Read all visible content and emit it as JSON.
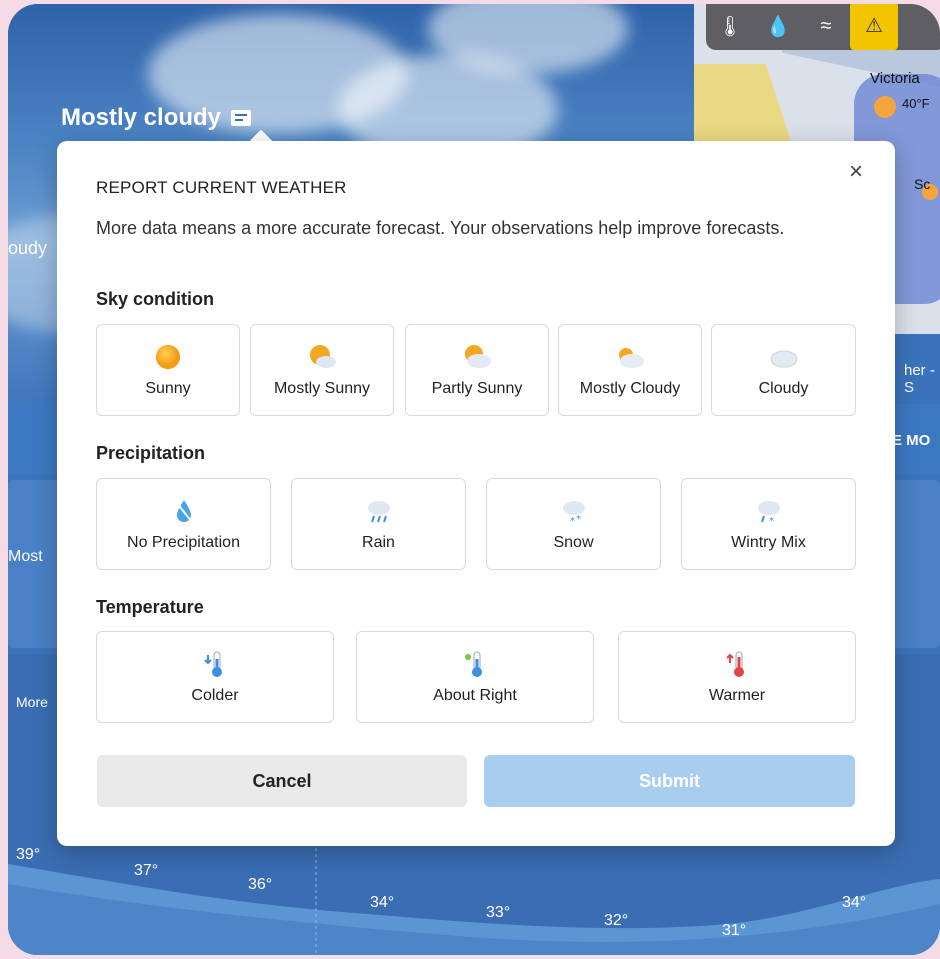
{
  "background": {
    "condition_label": "Mostly cloudy",
    "side_label_1": "oudy",
    "side_label_2": "Most",
    "side_label_3": "More",
    "band_label": "E MO",
    "map": {
      "city": "Victoria",
      "city_temp": "40°F",
      "city2": "Sc",
      "footer_text": "her - S",
      "toolbar_icons": [
        "thermometer-icon",
        "drop-icon",
        "wind-icon",
        "warning-icon"
      ]
    },
    "hourly_temps": [
      "39°",
      "37°",
      "36°",
      "34°",
      "33°",
      "32°",
      "31°",
      "34°"
    ]
  },
  "modal": {
    "title": "REPORT CURRENT WEATHER",
    "description": "More data means a more accurate forecast. Your observations help improve forecasts.",
    "sky": {
      "title": "Sky condition",
      "options": [
        {
          "label": "Sunny",
          "icon": "sun-icon"
        },
        {
          "label": "Mostly Sunny",
          "icon": "mostly-sunny-icon"
        },
        {
          "label": "Partly Sunny",
          "icon": "partly-sunny-icon"
        },
        {
          "label": "Mostly Cloudy",
          "icon": "mostly-cloudy-icon"
        },
        {
          "label": "Cloudy",
          "icon": "cloud-icon"
        }
      ]
    },
    "precipitation": {
      "title": "Precipitation",
      "options": [
        {
          "label": "No Precipitation",
          "icon": "no-precipitation-icon"
        },
        {
          "label": "Rain",
          "icon": "rain-icon"
        },
        {
          "label": "Snow",
          "icon": "snow-icon"
        },
        {
          "label": "Wintry Mix",
          "icon": "wintry-mix-icon"
        }
      ]
    },
    "temperature": {
      "title": "Temperature",
      "options": [
        {
          "label": "Colder",
          "icon": "colder-thermometer-icon"
        },
        {
          "label": "About Right",
          "icon": "about-right-thermometer-icon"
        },
        {
          "label": "Warmer",
          "icon": "warmer-thermometer-icon"
        }
      ]
    },
    "cancel_label": "Cancel",
    "submit_label": "Submit",
    "close_label": "×"
  },
  "colors": {
    "accent_disabled": "#a9cdee",
    "background_blue": "#3a74b8",
    "outer": "#f4dbe6"
  }
}
